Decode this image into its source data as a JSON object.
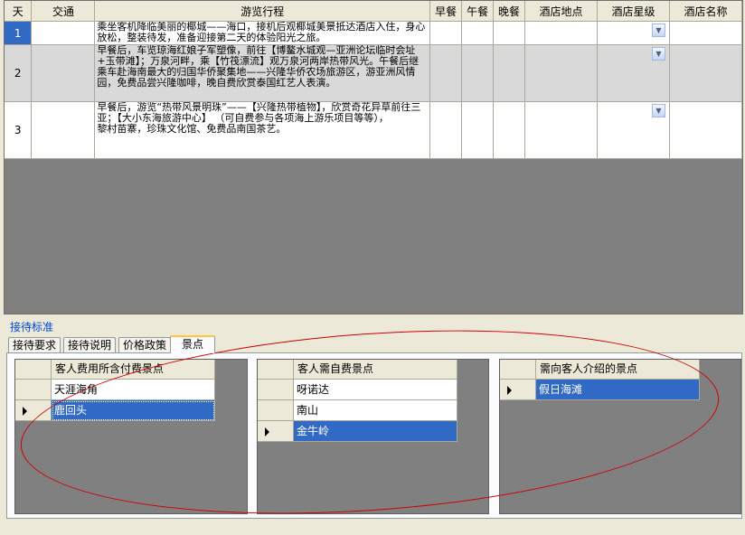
{
  "itinerary": {
    "columns": [
      "天",
      "交通",
      "游览行程",
      "早餐",
      "午餐",
      "晚餐",
      "酒店地点",
      "酒店星级",
      "酒店名称"
    ],
    "rows": [
      {
        "day": "1",
        "transport": "",
        "route": "乘坐客机降临美丽的椰城——海口，接机后观椰城美景抵达酒店入住，身心放松，整装待发，准备迎接第二天的体验阳光之旅。",
        "breakfast": "",
        "lunch": "",
        "dinner": "",
        "hotel_location": "",
        "hotel_star": "",
        "hotel_name": ""
      },
      {
        "day": "2",
        "transport": "",
        "route": "早餐后，车览琼海红娘子军塑像，前往【博鳌水城观—亚洲论坛临时会址+玉带滩】；万泉河畔，乘【竹筏漂流】观万泉河两岸热带风光。午餐后继乘车赴海南最大的归国华侨聚集地——兴隆华侨农场旅游区，游亚洲风情园，免费品尝兴隆咖啡，晚自费欣赏泰国红艺人表演。",
        "breakfast": "",
        "lunch": "",
        "dinner": "",
        "hotel_location": "",
        "hotel_star": "",
        "hotel_name": ""
      },
      {
        "day": "3",
        "transport": "",
        "route": "早餐后，游览“热带风景明珠”——【兴隆热带植物】，欣赏奇花异草前往三亚；【大小东海旅游中心】 （可自费参与各项海上游乐项目等等），\n黎村苗寨，珍珠文化馆、免费品南国茶艺。",
        "breakfast": "",
        "lunch": "",
        "dinner": "",
        "hotel_location": "",
        "hotel_star": "",
        "hotel_name": ""
      }
    ]
  },
  "group_caption": "接待标准",
  "tabs": [
    "接待要求",
    "接待说明",
    "价格政策",
    "景点"
  ],
  "active_tab": "景点",
  "panels": [
    {
      "header": "客人费用所含付费景点",
      "rows": [
        "天涯海角",
        "鹿回头"
      ],
      "selected": 1
    },
    {
      "header": "客人需自费景点",
      "rows": [
        "呀诺达",
        "南山",
        "金牛岭"
      ],
      "selected": 2
    },
    {
      "header": "需向客人介绍的景点",
      "rows": [
        "假日海滩"
      ],
      "selected": 0
    }
  ],
  "colors": {
    "selection": "#316ac5",
    "annotation": "#d00000",
    "group_caption": "#0046d5",
    "tab_highlight": "#ffc83c"
  },
  "icons": {
    "dropdown": "chevron-down-icon",
    "row_pointer": "row-pointer-icon"
  }
}
